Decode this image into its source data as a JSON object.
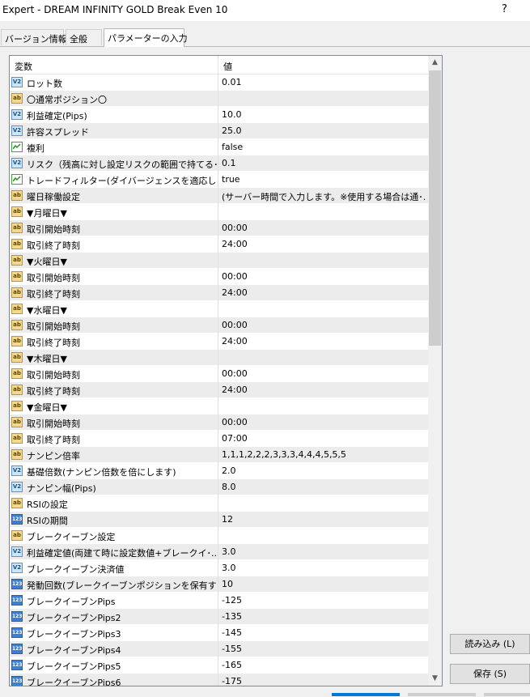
{
  "window": {
    "title": "Expert - DREAM INFINITY GOLD Break Even 10",
    "help": "?"
  },
  "tabs": [
    {
      "label": "バージョン情報",
      "active": false
    },
    {
      "label": "全般",
      "active": false
    },
    {
      "label": "パラメーターの入力",
      "active": true
    }
  ],
  "grid": {
    "col_variable": "変数",
    "col_value": "値",
    "rows": [
      {
        "type": "v2",
        "name": "ロット数",
        "value": "0.01"
      },
      {
        "type": "ab",
        "name": "〇通常ポジション〇",
        "value": ""
      },
      {
        "type": "v2",
        "name": "利益確定(Pips)",
        "value": "10.0"
      },
      {
        "type": "v2",
        "name": "許容スプレッド",
        "value": "25.0"
      },
      {
        "type": "bool",
        "name": "複利",
        "value": "false"
      },
      {
        "type": "v2",
        "name": "リスク（残高に対し設定リスクの範囲で持てる･..",
        "value": "0.1"
      },
      {
        "type": "bool",
        "name": "トレードフィルター(ダイバージェンスを適応します)",
        "value": "true"
      },
      {
        "type": "ab",
        "name": "曜日稼働設定",
        "value": "(サーバー時間で入力します。※使用する場合は通･.."
      },
      {
        "type": "ab",
        "name": "▼月曜日▼",
        "value": ""
      },
      {
        "type": "ab",
        "name": "取引開始時刻",
        "value": "00:00"
      },
      {
        "type": "ab",
        "name": "取引終了時刻",
        "value": "24:00"
      },
      {
        "type": "ab",
        "name": "▼火曜日▼",
        "value": ""
      },
      {
        "type": "ab",
        "name": "取引開始時刻",
        "value": "00:00"
      },
      {
        "type": "ab",
        "name": "取引終了時刻",
        "value": "24:00"
      },
      {
        "type": "ab",
        "name": "▼水曜日▼",
        "value": ""
      },
      {
        "type": "ab",
        "name": "取引開始時刻",
        "value": "00:00"
      },
      {
        "type": "ab",
        "name": "取引終了時刻",
        "value": "24:00"
      },
      {
        "type": "ab",
        "name": "▼木曜日▼",
        "value": ""
      },
      {
        "type": "ab",
        "name": "取引開始時刻",
        "value": "00:00"
      },
      {
        "type": "ab",
        "name": "取引終了時刻",
        "value": "24:00"
      },
      {
        "type": "ab",
        "name": "▼金曜日▼",
        "value": ""
      },
      {
        "type": "ab",
        "name": "取引開始時刻",
        "value": "00:00"
      },
      {
        "type": "ab",
        "name": "取引終了時刻",
        "value": "07:00"
      },
      {
        "type": "ab",
        "name": "ナンピン倍率",
        "value": "1,1,1,2,2,2,3,3,3,4,4,4,5,5,5"
      },
      {
        "type": "v2",
        "name": "基礎倍数(ナンピン倍数を倍にします)",
        "value": "2.0"
      },
      {
        "type": "v2",
        "name": "ナンピン幅(Pips)",
        "value": "8.0"
      },
      {
        "type": "ab",
        "name": "RSIの設定",
        "value": ""
      },
      {
        "type": "n123",
        "name": "RSIの期間",
        "value": "12"
      },
      {
        "type": "ab",
        "name": "ブレークイーブン設定",
        "value": ""
      },
      {
        "type": "v2",
        "name": "利益確定値(両建て時に設定数値+ブレークイ･..",
        "value": "3.0"
      },
      {
        "type": "v2",
        "name": "ブレークイーブン決済値",
        "value": "3.0"
      },
      {
        "type": "n123",
        "name": "発動回数(ブレークイーブンポジションを保有する･..",
        "value": "10"
      },
      {
        "type": "n123",
        "name": "ブレークイーブンPips",
        "value": "-125"
      },
      {
        "type": "n123",
        "name": "ブレークイーブンPips2",
        "value": "-135"
      },
      {
        "type": "n123",
        "name": "ブレークイーブンPips3",
        "value": "-145"
      },
      {
        "type": "n123",
        "name": "ブレークイーブンPips4",
        "value": "-155"
      },
      {
        "type": "n123",
        "name": "ブレークイーブンPips5",
        "value": "-165"
      },
      {
        "type": "n123",
        "name": "ブレークイーブンPips6",
        "value": "-175"
      }
    ]
  },
  "icon_labels": {
    "ab": "ab",
    "v2": "V2",
    "n123": "123"
  },
  "buttons": {
    "load": "読み込み (L)",
    "save": "保存 (S)"
  }
}
